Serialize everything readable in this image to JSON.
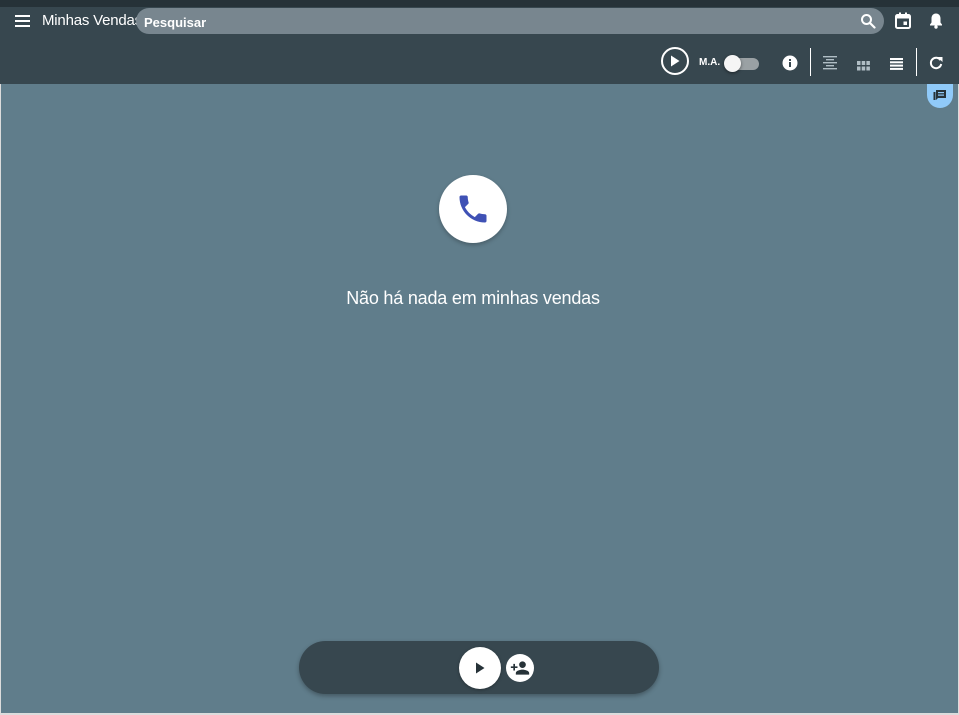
{
  "header": {
    "title": "Minhas Vendas",
    "search_placeholder": "Pesquisar",
    "icons": [
      "menu-icon",
      "search-icon",
      "calendar-icon",
      "bell-icon"
    ]
  },
  "toolbar": {
    "ma_label": "M.A.",
    "toggle_on": false,
    "icons": [
      "play-circle-icon",
      "info-icon",
      "align-center-icon",
      "grid-view-icon",
      "list-view-icon",
      "refresh-icon"
    ]
  },
  "main": {
    "empty_icon": "phone-icon",
    "empty_message": "Não há nada em minhas vendas"
  },
  "bottom_bar": {
    "icons": [
      "play-icon",
      "add-person-icon"
    ]
  },
  "colors": {
    "background": "#607d8b",
    "topbar": "#37474f",
    "accent_phone": "#3f51b5",
    "chat_tab": "#90caf9"
  }
}
